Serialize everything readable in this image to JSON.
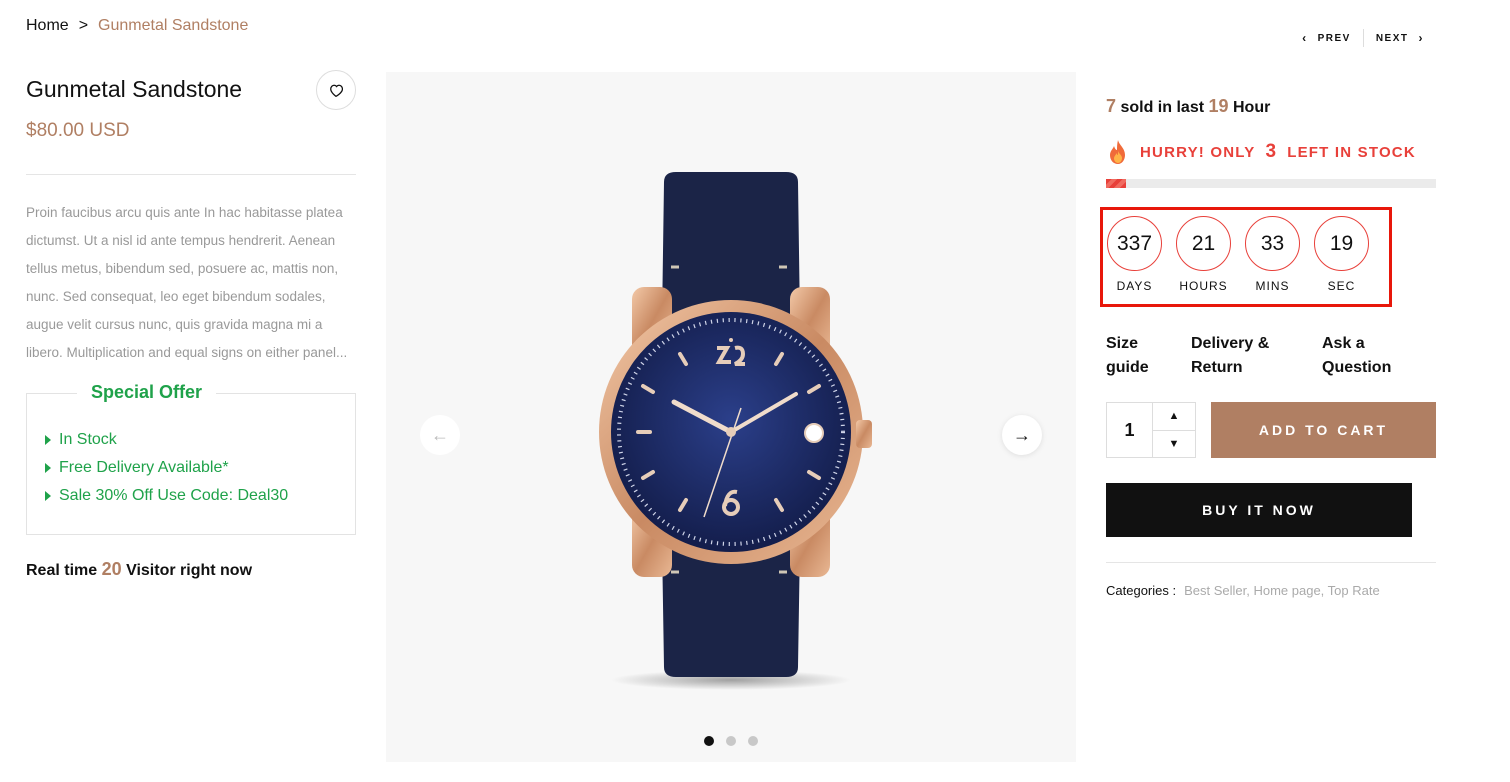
{
  "breadcrumb": {
    "home": "Home",
    "separator": ">",
    "current": "Gunmetal Sandstone"
  },
  "pager": {
    "prev": "PREV",
    "next": "NEXT"
  },
  "product": {
    "title": "Gunmetal Sandstone",
    "price": "$80.00 USD",
    "description": "Proin faucibus arcu quis ante  In hac habitasse platea dictumst. Ut a nisl id ante tempus hendrerit. Aenean tellus metus, bibendum sed, posuere ac, mattis non, nunc. Sed consequat, leo eget bibendum sodales, augue velit cursus nunc, quis gravida magna mi a libero. Multiplication and equal signs on either panel..."
  },
  "offer": {
    "title": "Special Offer",
    "items": [
      "In Stock",
      "Free Delivery Available*",
      "Sale 30% Off Use Code: Deal30"
    ]
  },
  "visitors": {
    "prefix": "Real time",
    "count": "20",
    "suffix": "Visitor right now"
  },
  "sold": {
    "count": "7",
    "middle": "sold in last",
    "hours": "19",
    "suffix": "Hour"
  },
  "stock": {
    "prefix": "HURRY! ONLY",
    "count": "3",
    "suffix": "LEFT IN STOCK",
    "fill_percent": 6
  },
  "countdown": [
    {
      "value": "337",
      "label": "DAYS"
    },
    {
      "value": "21",
      "label": "HOURS"
    },
    {
      "value": "33",
      "label": "MINS"
    },
    {
      "value": "19",
      "label": "SEC"
    }
  ],
  "links": {
    "size_guide": [
      "Size",
      "guide"
    ],
    "delivery": [
      "Delivery &",
      "Return"
    ],
    "ask": [
      "Ask a",
      "Question"
    ]
  },
  "quantity": "1",
  "buttons": {
    "add_to_cart": "ADD TO CART",
    "buy_now": "BUY IT NOW"
  },
  "categories": {
    "label": "Categories :",
    "items": "Best Seller, Home page, Top Rate"
  },
  "gallery": {
    "slide_count": 3,
    "active_slide": 1
  },
  "colors": {
    "accent": "#b07f63",
    "offer_green": "#1fa24a",
    "alert_red": "#e8403a",
    "highlight_box": "#e8170a"
  },
  "icons": {
    "wishlist": "heart-icon",
    "fire": "fire-icon",
    "prev_arrow": "arrow-left-icon",
    "next_arrow": "arrow-right-icon"
  }
}
